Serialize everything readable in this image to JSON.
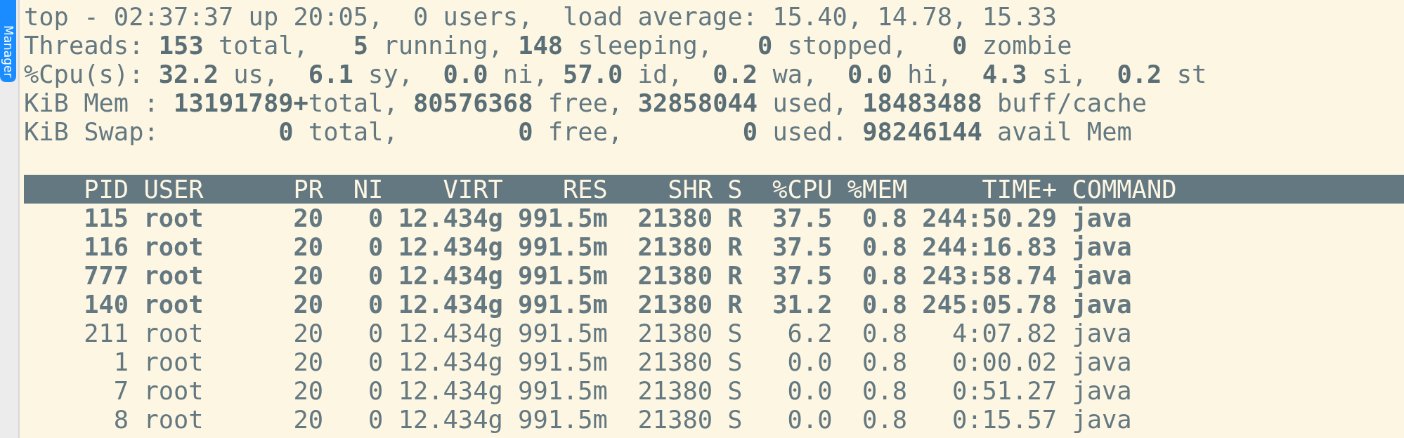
{
  "dock": {
    "tab_label": "Manager"
  },
  "summary": [
    "top - 02:37:37 up 20:05,  0 users,  load average: 15.40, 14.78, 15.33",
    "Threads: **153** total,   **5** running, **148** sleeping,   **0** stopped,   **0** zombie",
    "%Cpu(s): **32.2** us,  **6.1** sy,  **0.0** ni, **57.0** id,  **0.2** wa,  **0.0** hi,  **4.3** si,  **0.2** st",
    "KiB Mem : **13191789+**total, **80576368** free, **32858044** used, **18483488** buff/cache",
    "KiB Swap:        **0** total,        **0** free,        **0** used. **98246144** avail Mem"
  ],
  "table": {
    "columns": [
      "PID",
      "USER",
      "PR",
      "NI",
      "VIRT",
      "RES",
      "SHR",
      "S",
      "%CPU",
      "%MEM",
      "TIME+",
      "COMMAND"
    ],
    "rows": [
      {
        "cells": [
          "115",
          "root",
          "20",
          "0",
          "12.434g",
          "991.5m",
          "21380",
          "R",
          "37.5",
          "0.8",
          "244:50.29",
          "java"
        ],
        "highlighted": true
      },
      {
        "cells": [
          "116",
          "root",
          "20",
          "0",
          "12.434g",
          "991.5m",
          "21380",
          "R",
          "37.5",
          "0.8",
          "244:16.83",
          "java"
        ],
        "highlighted": true
      },
      {
        "cells": [
          "777",
          "root",
          "20",
          "0",
          "12.434g",
          "991.5m",
          "21380",
          "R",
          "37.5",
          "0.8",
          "243:58.74",
          "java"
        ],
        "highlighted": true
      },
      {
        "cells": [
          "140",
          "root",
          "20",
          "0",
          "12.434g",
          "991.5m",
          "21380",
          "R",
          "31.2",
          "0.8",
          "245:05.78",
          "java"
        ],
        "highlighted": true
      },
      {
        "cells": [
          "211",
          "root",
          "20",
          "0",
          "12.434g",
          "991.5m",
          "21380",
          "S",
          "6.2",
          "0.8",
          "4:07.82",
          "java"
        ],
        "highlighted": false
      },
      {
        "cells": [
          "1",
          "root",
          "20",
          "0",
          "12.434g",
          "991.5m",
          "21380",
          "S",
          "0.0",
          "0.8",
          "0:00.02",
          "java"
        ],
        "highlighted": false
      },
      {
        "cells": [
          "7",
          "root",
          "20",
          "0",
          "12.434g",
          "991.5m",
          "21380",
          "S",
          "0.0",
          "0.8",
          "0:51.27",
          "java"
        ],
        "highlighted": false
      },
      {
        "cells": [
          "8",
          "root",
          "20",
          "0",
          "12.434g",
          "991.5m",
          "21380",
          "S",
          "0.0",
          "0.8",
          "0:15.57",
          "java"
        ],
        "highlighted": false
      }
    ]
  }
}
